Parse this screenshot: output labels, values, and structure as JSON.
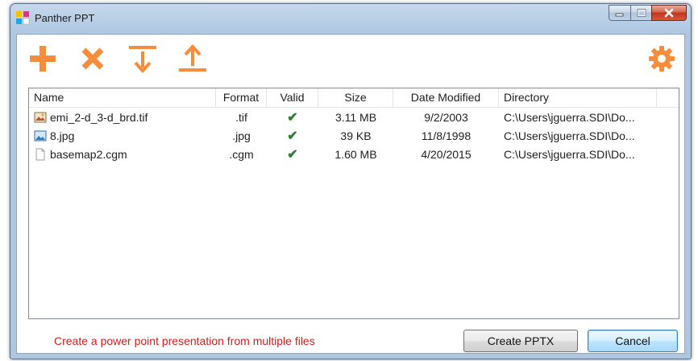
{
  "window": {
    "title": "Panther PPT",
    "controls": {
      "minimize": "minimize",
      "maximize": "maximize",
      "close": "close"
    }
  },
  "toolbar": {
    "accent_color": "#f58d3c",
    "buttons": [
      {
        "name": "add-icon"
      },
      {
        "name": "remove-icon"
      },
      {
        "name": "move-down-icon"
      },
      {
        "name": "move-up-icon"
      },
      {
        "name": "settings-icon"
      }
    ]
  },
  "file_list": {
    "columns": [
      "Name",
      "Format",
      "Valid",
      "Size",
      "Date Modified",
      "Directory"
    ],
    "rows": [
      {
        "icon": "image-file-icon",
        "name": "emi_2-d_3-d_brd.tif",
        "format": ".tif",
        "valid": "✔",
        "size": "3.11 MB",
        "date": "9/2/2003",
        "directory": "C:\\Users\\jguerra.SDI\\Do..."
      },
      {
        "icon": "picture-file-icon",
        "name": "8.jpg",
        "format": ".jpg",
        "valid": "✔",
        "size": "39 KB",
        "date": "11/8/1998",
        "directory": "C:\\Users\\jguerra.SDI\\Do..."
      },
      {
        "icon": "blank-file-icon",
        "name": "basemap2.cgm",
        "format": ".cgm",
        "valid": "✔",
        "size": "1.60 MB",
        "date": "4/20/2015",
        "directory": "C:\\Users\\jguerra.SDI\\Do..."
      }
    ]
  },
  "footer": {
    "message": "Create a power point presentation from multiple files",
    "create_label": "Create PPTX",
    "cancel_label": "Cancel"
  }
}
